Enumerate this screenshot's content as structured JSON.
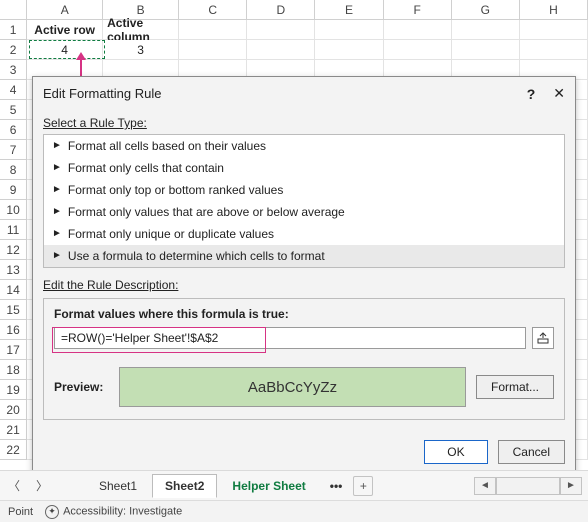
{
  "grid": {
    "cols": [
      "A",
      "B",
      "C",
      "D",
      "E",
      "F",
      "G",
      "H"
    ],
    "rows_visible": 22,
    "headers": {
      "a1": "Active row",
      "b1": "Active column"
    },
    "values": {
      "a2": "4",
      "b2": "3"
    }
  },
  "dialog": {
    "title": "Edit Formatting Rule",
    "section_type": "Select a Rule Type:",
    "rules": [
      "Format all cells based on their values",
      "Format only cells that contain",
      "Format only top or bottom ranked values",
      "Format only values that are above or below average",
      "Format only unique or duplicate values",
      "Use a formula to determine which cells to format"
    ],
    "selected_rule_index": 5,
    "section_desc": "Edit the Rule Description:",
    "formula_label": "Format values where this formula is true:",
    "formula_value": "=ROW()='Helper Sheet'!$A$2",
    "preview_label": "Preview:",
    "preview_text": "AaBbCcYyZz",
    "format_btn": "Format...",
    "ok": "OK",
    "cancel": "Cancel"
  },
  "tabs": {
    "items": [
      "Sheet1",
      "Sheet2",
      "Helper Sheet"
    ],
    "active_index": 1,
    "more": "•••"
  },
  "status": {
    "mode": "Point",
    "acc": "Accessibility: Investigate"
  },
  "chart_data": null
}
